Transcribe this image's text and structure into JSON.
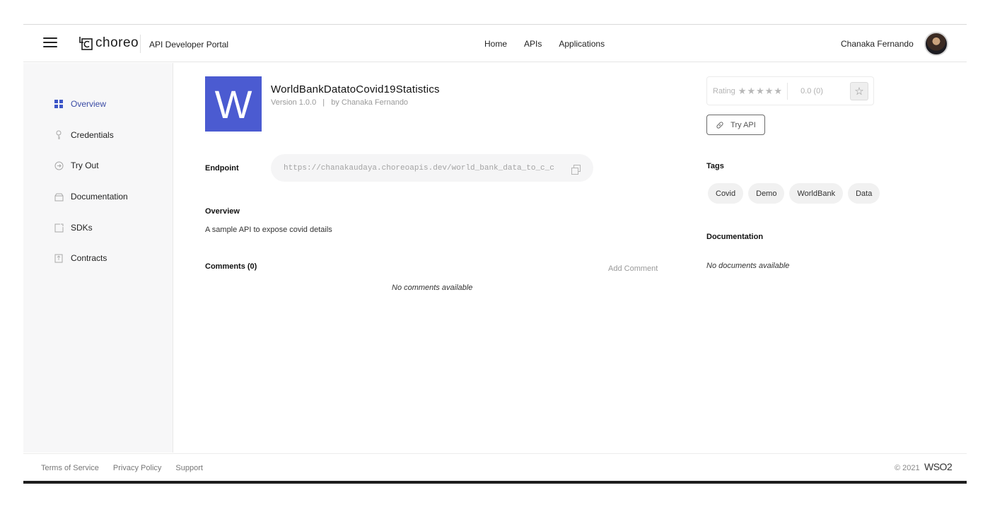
{
  "header": {
    "logo_text": "choreo",
    "portal_title": "API Developer Portal",
    "nav": [
      "Home",
      "APIs",
      "Applications"
    ],
    "user_name": "Chanaka Fernando"
  },
  "sidebar": {
    "items": [
      {
        "label": "Overview",
        "icon": "grid-icon",
        "active": true
      },
      {
        "label": "Credentials",
        "icon": "key-icon"
      },
      {
        "label": "Try Out",
        "icon": "arrow-circle-icon"
      },
      {
        "label": "Documentation",
        "icon": "document-icon"
      },
      {
        "label": "SDKs",
        "icon": "sdk-icon"
      },
      {
        "label": "Contracts",
        "icon": "contract-icon"
      }
    ]
  },
  "api": {
    "thumbnail_letter": "W",
    "name": "WorldBankDatatoCovid19Statistics",
    "version": "Version 1.0.0",
    "meta_sep": "|",
    "author": "by Chanaka Fernando",
    "endpoint_label": "Endpoint",
    "endpoint_url": "https://chanakaudaya.choreoapis.dev/world_bank_data_to_c_c",
    "overview_title": "Overview",
    "description": "A sample API to expose covid details",
    "comments_title": "Comments (0)",
    "add_comment": "Add Comment",
    "no_comments": "No comments available"
  },
  "right": {
    "rating_label": "Rating",
    "stars_symbol": "★★★★★",
    "rating_value": "0.0 (0)",
    "star_button_symbol": "☆",
    "try_api": "Try API",
    "tags_title": "Tags",
    "tags": [
      "Covid",
      "Demo",
      "WorldBank",
      "Data"
    ],
    "documentation_title": "Documentation",
    "no_docs": "No documents available"
  },
  "footer": {
    "links": [
      "Terms of Service",
      "Privacy Policy",
      "Support"
    ],
    "copyright": "© 2021",
    "brand": "WSO2"
  },
  "colors": {
    "accent": "#4b5bd1",
    "sidebar_bg": "#f7f7f8"
  }
}
